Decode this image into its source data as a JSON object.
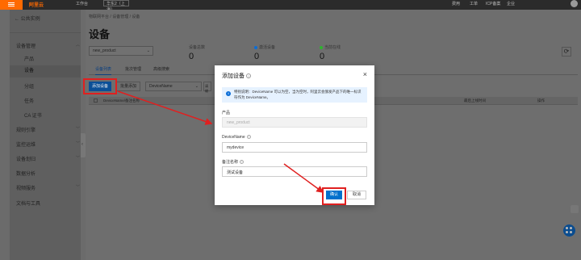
{
  "topbar": {
    "logo": "阿里云",
    "workspace": "工作台",
    "region": "华东2（上海）",
    "nav": [
      "费用",
      "工单",
      "ICP备案",
      "企业"
    ]
  },
  "sidebar": {
    "back_label": "公共实例",
    "items": [
      {
        "label": "设备管理",
        "expandable": true,
        "level": 1
      },
      {
        "label": "产品",
        "level": 2
      },
      {
        "label": "设备",
        "level": 2,
        "active": true
      },
      {
        "label": "分组",
        "level": 2
      },
      {
        "label": "任务",
        "level": 2
      },
      {
        "label": "CA 证书",
        "level": 2
      },
      {
        "label": "规则引擎",
        "expandable": true,
        "level": 1
      },
      {
        "label": "监控运维",
        "expandable": true,
        "level": 1
      },
      {
        "label": "设备划归",
        "expandable": true,
        "level": 1
      },
      {
        "label": "数据分析",
        "expandable": false,
        "level": 1
      },
      {
        "label": "视频服务",
        "expandable": true,
        "level": 1
      },
      {
        "label": "文档与工具",
        "expandable": false,
        "level": 1
      }
    ]
  },
  "main": {
    "breadcrumb": [
      "物联网平台",
      "设备管理",
      "设备"
    ],
    "title": "设备",
    "product_select": "new_product",
    "stats": [
      {
        "label": "设备总数",
        "value": "0",
        "color": ""
      },
      {
        "label": "激活设备",
        "value": "0",
        "color": "#0b6dd6"
      },
      {
        "label": "当前在线",
        "value": "0",
        "color": "#2db32d"
      }
    ],
    "tabs": [
      "设备列表",
      "批次管理",
      "高级搜索"
    ],
    "add_button": "添加设备",
    "batch_button": "批量添加",
    "filter_select": "DeviceName",
    "filter_edge": "请输",
    "table_headers": [
      "DeviceName/备注名称",
      "最后上线时间",
      "操作"
    ]
  },
  "modal": {
    "title": "添加设备",
    "notice": "特别说明：DeviceName 可以为空，当为空时，阿里云会颁发产品下的唯一标识符作为 DeviceName。",
    "product_label": "产品",
    "product_value": "new_product",
    "devicename_label": "DeviceName",
    "devicename_value": "mydevice",
    "remark_label": "备注名称",
    "remark_value": "测试设备",
    "ok_label": "确认",
    "cancel_label": "取消"
  },
  "colors": {
    "accent": "#ff6a00",
    "primary_button": "#0070cc",
    "highlight": "#e02020"
  }
}
